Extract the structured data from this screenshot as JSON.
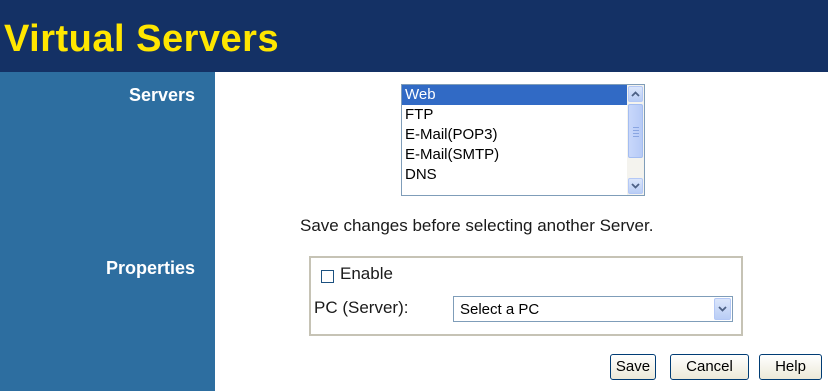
{
  "page": {
    "title": "Virtual Servers"
  },
  "sidebar": {
    "servers_label": "Servers",
    "properties_label": "Properties"
  },
  "servers": {
    "items": [
      "Web",
      "FTP",
      "E-Mail(POP3)",
      "E-Mail(SMTP)",
      "DNS"
    ],
    "selected": "Web"
  },
  "note": "Save changes before selecting another Server.",
  "properties": {
    "enable_label": "Enable",
    "enable_checked": false,
    "pc_label": "PC (Server):",
    "pc_select_value": "Select a PC"
  },
  "buttons": {
    "save": "Save",
    "cancel": "Cancel",
    "help": "Help"
  },
  "icons": {
    "scroll_up": "scroll-up-arrow-icon",
    "scroll_down": "scroll-down-arrow-icon",
    "dropdown": "chevron-down-icon"
  },
  "colors": {
    "title_bg": "#143165",
    "title_text": "#ffe600",
    "sidebar_bg": "#2d6ea0",
    "selection": "#316ac5"
  }
}
